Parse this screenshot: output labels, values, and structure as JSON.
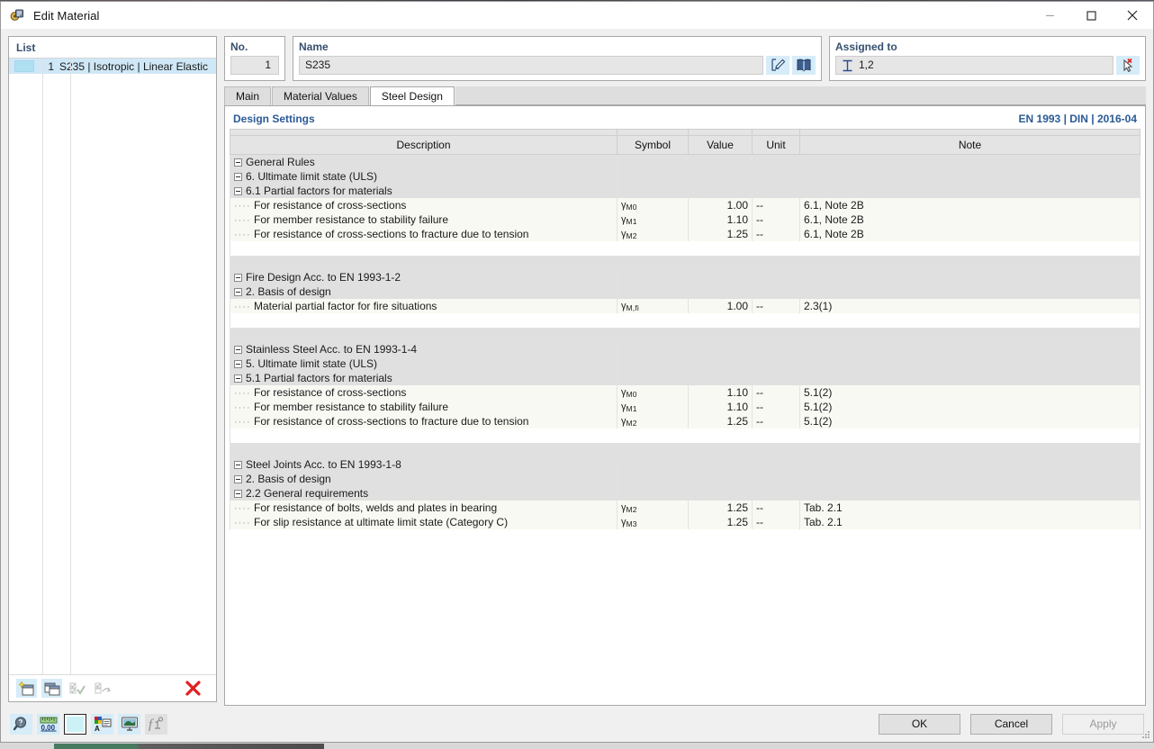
{
  "window": {
    "title": "Edit Material",
    "app_icon": "material-icon",
    "minimize": "minimize-icon",
    "maximize": "maximize-icon",
    "close": "close-icon"
  },
  "list_panel": {
    "caption": "List",
    "rows": [
      {
        "number": "1",
        "label": "S235 | Isotropic | Linear Elastic"
      }
    ],
    "toolbar": [
      {
        "name": "new-material-button",
        "icon": "new-window-icon",
        "enabled": true
      },
      {
        "name": "copy-material-button",
        "icon": "copy-window-icon",
        "enabled": true
      },
      {
        "name": "check-all-button",
        "icon": "checklist-check-icon",
        "enabled": false
      },
      {
        "name": "reset-selection-button",
        "icon": "checklist-refresh-icon",
        "enabled": false
      },
      {
        "name": "delete-material-button",
        "icon": "red-x-icon",
        "enabled": true
      }
    ]
  },
  "no_group": {
    "caption": "No.",
    "value": "1"
  },
  "name_group": {
    "caption": "Name",
    "value": "S235",
    "buttons": [
      {
        "name": "edit-name-button",
        "icon": "edit-pencil-icon"
      },
      {
        "name": "material-library-button",
        "icon": "book-icon"
      }
    ]
  },
  "assigned_group": {
    "caption": "Assigned to",
    "icon": "i-beam-icon",
    "value": "1,2",
    "pick_button": {
      "name": "pick-objects-button",
      "icon": "cursor-pick-icon"
    }
  },
  "tabs": [
    {
      "label": "Main",
      "active": false
    },
    {
      "label": "Material Values",
      "active": false
    },
    {
      "label": "Steel Design",
      "active": true
    }
  ],
  "design_settings": {
    "caption": "Design Settings",
    "standard": "EN 1993 | DIN | 2016-04",
    "columns": [
      "Description",
      "Symbol",
      "Value",
      "Unit",
      "Note"
    ],
    "rows": [
      {
        "type": "group",
        "level": 1,
        "description": "General Rules"
      },
      {
        "type": "group",
        "level": 2,
        "description": "6. Ultimate limit state (ULS)"
      },
      {
        "type": "group",
        "level": 3,
        "description": "6.1 Partial factors for materials"
      },
      {
        "type": "leaf",
        "level": 4,
        "description": "For resistance of cross-sections",
        "symbol": "γ",
        "sub": "M0",
        "value": "1.00",
        "unit": "--",
        "note": "6.1, Note 2B"
      },
      {
        "type": "leaf",
        "level": 4,
        "description": "For member resistance to stability failure",
        "symbol": "γ",
        "sub": "M1",
        "value": "1.10",
        "unit": "--",
        "note": "6.1, Note 2B"
      },
      {
        "type": "leaf",
        "level": 4,
        "description": "For resistance of cross-sections to fracture due to tension",
        "symbol": "γ",
        "sub": "M2",
        "value": "1.25",
        "unit": "--",
        "note": "6.1, Note 2B"
      },
      {
        "type": "gap"
      },
      {
        "type": "gap2"
      },
      {
        "type": "group",
        "level": 1,
        "description": "Fire Design Acc. to EN 1993-1-2"
      },
      {
        "type": "group",
        "level": 2,
        "description": "2. Basis of design"
      },
      {
        "type": "leaf",
        "level": 3,
        "description": "Material partial factor for fire situations",
        "symbol": "γ",
        "sub": "M,fi",
        "value": "1.00",
        "unit": "--",
        "note": "2.3(1)"
      },
      {
        "type": "gap"
      },
      {
        "type": "gap2"
      },
      {
        "type": "group",
        "level": 1,
        "description": "Stainless Steel Acc. to EN 1993-1-4"
      },
      {
        "type": "group",
        "level": 2,
        "description": "5. Ultimate limit state (ULS)"
      },
      {
        "type": "group",
        "level": 3,
        "description": "5.1 Partial factors for materials"
      },
      {
        "type": "leaf",
        "level": 4,
        "description": "For resistance of cross-sections",
        "symbol": "γ",
        "sub": "M0",
        "value": "1.10",
        "unit": "--",
        "note": "5.1(2)"
      },
      {
        "type": "leaf",
        "level": 4,
        "description": "For member resistance to stability failure",
        "symbol": "γ",
        "sub": "M1",
        "value": "1.10",
        "unit": "--",
        "note": "5.1(2)"
      },
      {
        "type": "leaf",
        "level": 4,
        "description": "For resistance of cross-sections to fracture due to tension",
        "symbol": "γ",
        "sub": "M2",
        "value": "1.25",
        "unit": "--",
        "note": "5.1(2)"
      },
      {
        "type": "gap"
      },
      {
        "type": "gap2"
      },
      {
        "type": "group",
        "level": 1,
        "description": "Steel Joints Acc. to EN 1993-1-8"
      },
      {
        "type": "group",
        "level": 2,
        "description": "2. Basis of design"
      },
      {
        "type": "group",
        "level": 3,
        "description": "2.2 General requirements"
      },
      {
        "type": "leaf",
        "level": 4,
        "description": "For resistance of bolts, welds and plates in bearing",
        "symbol": "γ",
        "sub": "M2",
        "value": "1.25",
        "unit": "--",
        "note": "Tab. 2.1"
      },
      {
        "type": "leaf",
        "level": 4,
        "description": "For slip resistance at ultimate limit state (Category C)",
        "symbol": "γ",
        "sub": "M3",
        "value": "1.25",
        "unit": "--",
        "note": "Tab. 2.1"
      }
    ]
  },
  "bottom_toolbar": [
    {
      "name": "info-button",
      "icon": "magnifier-question-icon",
      "enabled": true
    },
    {
      "name": "units-decimals-button",
      "icon": "ruler-decimals-icon",
      "enabled": true
    },
    {
      "name": "color-button",
      "icon": "color-swatch-icon",
      "enabled": true
    },
    {
      "name": "display-properties-button",
      "icon": "colors-label-icon",
      "enabled": true
    },
    {
      "name": "graphic-button",
      "icon": "monitor-icon",
      "enabled": true
    },
    {
      "name": "formula-button",
      "icon": "function-icon",
      "enabled": false
    }
  ],
  "dialog_buttons": [
    {
      "label": "OK",
      "name": "ok-button",
      "enabled": true
    },
    {
      "label": "Cancel",
      "name": "cancel-button",
      "enabled": true
    },
    {
      "label": "Apply",
      "name": "apply-button",
      "enabled": false
    }
  ],
  "colors": {
    "caption_blue": "#36506e",
    "standard_blue": "#2b5a96",
    "selection": "#cfe8f7",
    "icon_bg": "#d6ecf8",
    "group_row": "#e0e0e0",
    "leaf_row": "#f9f9f3",
    "delete_red": "#e02020"
  }
}
